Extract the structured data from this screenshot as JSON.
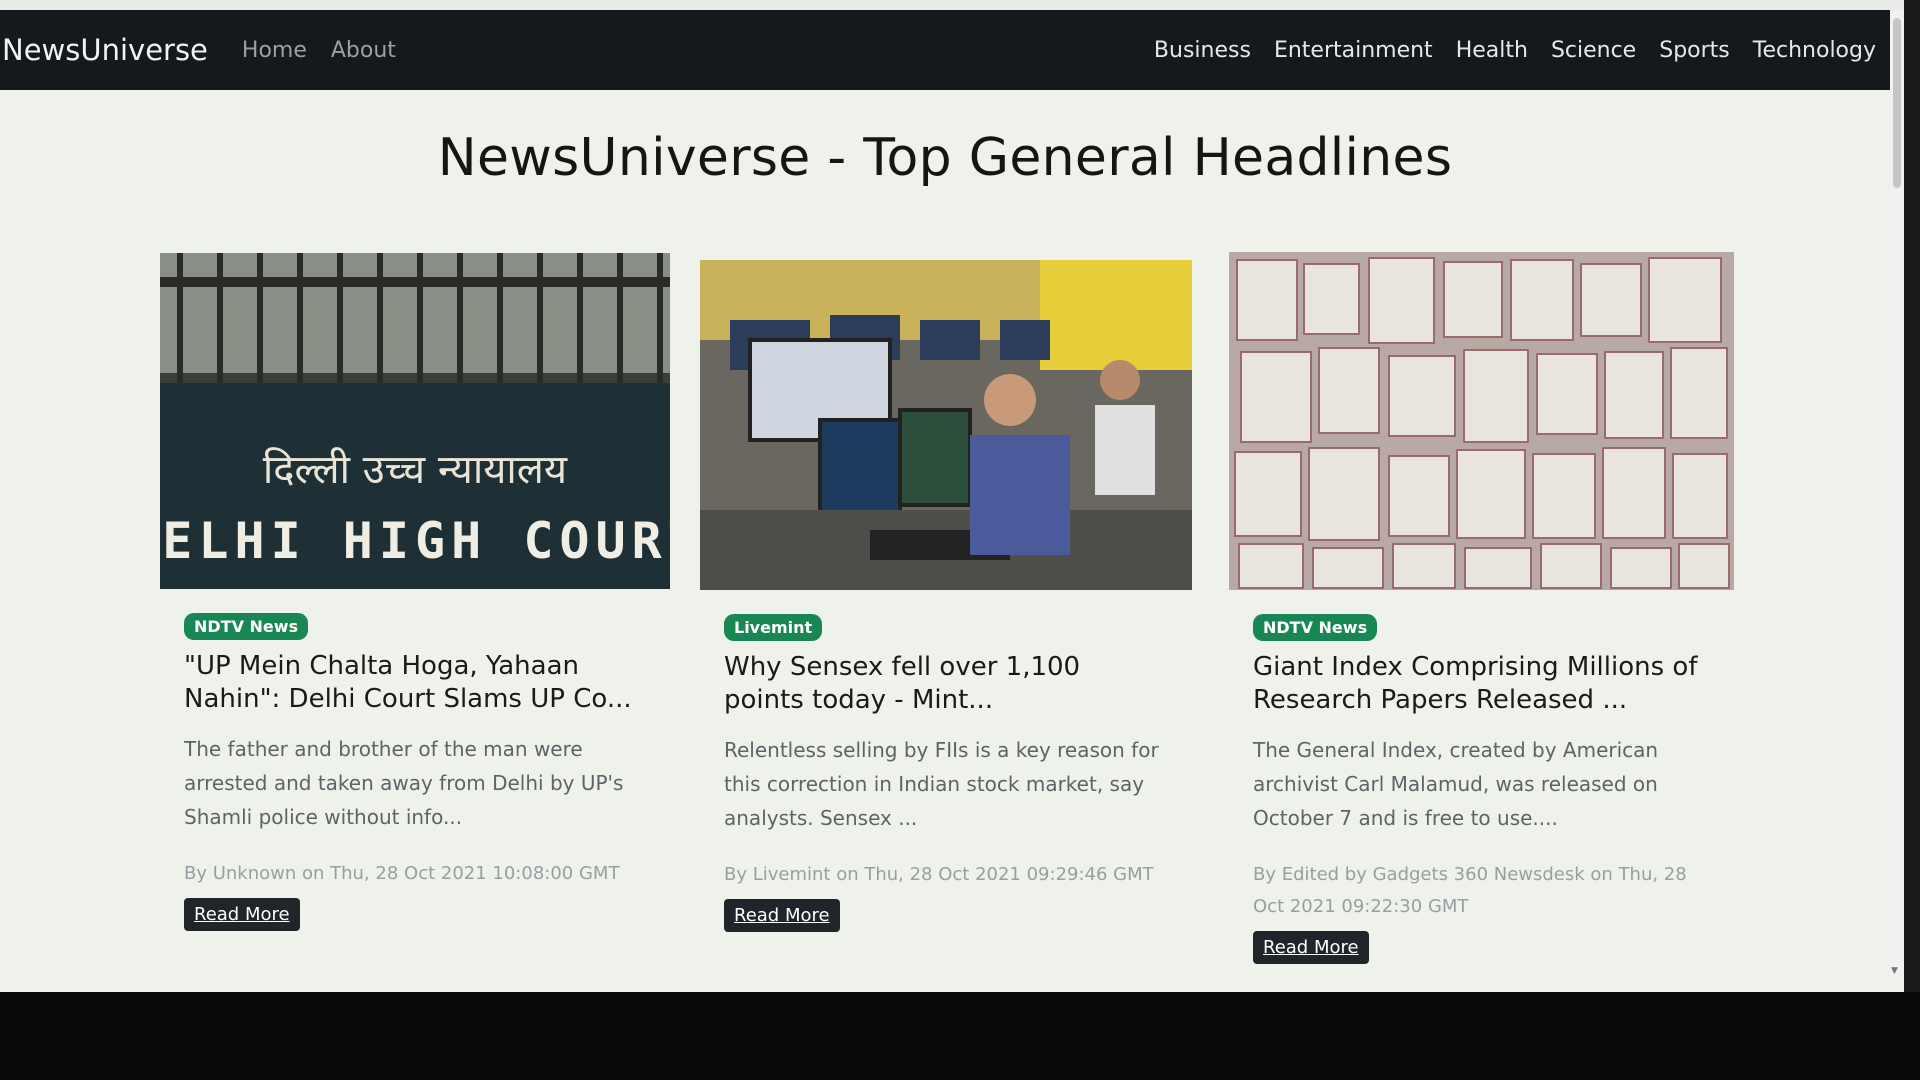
{
  "navbar": {
    "brand": "NewsUniverse",
    "left_links": [
      {
        "label": "Home"
      },
      {
        "label": "About"
      }
    ],
    "right_links": [
      {
        "label": "Business"
      },
      {
        "label": "Entertainment"
      },
      {
        "label": "Health"
      },
      {
        "label": "Science"
      },
      {
        "label": "Sports"
      },
      {
        "label": "Technology"
      }
    ]
  },
  "main": {
    "title": "NewsUniverse - Top General Headlines",
    "cards": [
      {
        "source": "NDTV News",
        "title": "\"UP Mein Chalta Hoga, Yahaan Nahin\": Delhi Court Slams UP Co...",
        "description": "The father and brother of the man were arrested and taken away from Delhi by UP's Shamli police without info...",
        "meta": "By Unknown on Thu, 28 Oct 2021 10:08:00 GMT",
        "button": "Read More",
        "image_text_hindi": "दिल्ली  उच्च  न्यायालय",
        "image_text_english": "DELHI HIGH COURT"
      },
      {
        "source": "Livemint",
        "title": "Why Sensex fell over 1,100 points today - Mint...",
        "description": "Relentless selling by FIIs is a key reason for this correction in Indian stock market, say analysts. Sensex ...",
        "meta": "By Livemint on Thu, 28 Oct 2021 09:29:46 GMT",
        "button": "Read More"
      },
      {
        "source": "NDTV News",
        "title": "Giant Index Comprising Millions of Research Papers Released ...",
        "description": "The General Index, created by American archivist Carl Malamud, was released on October 7 and is free to use....",
        "meta": "By Edited by Gadgets 360 Newsdesk on Thu, 28 Oct 2021 09:22:30 GMT",
        "button": "Read More"
      }
    ]
  },
  "colors": {
    "navbar_bg": "#15181c",
    "badge_bg": "#198754",
    "button_bg": "#212529",
    "page_bg": "#eef2ea"
  }
}
